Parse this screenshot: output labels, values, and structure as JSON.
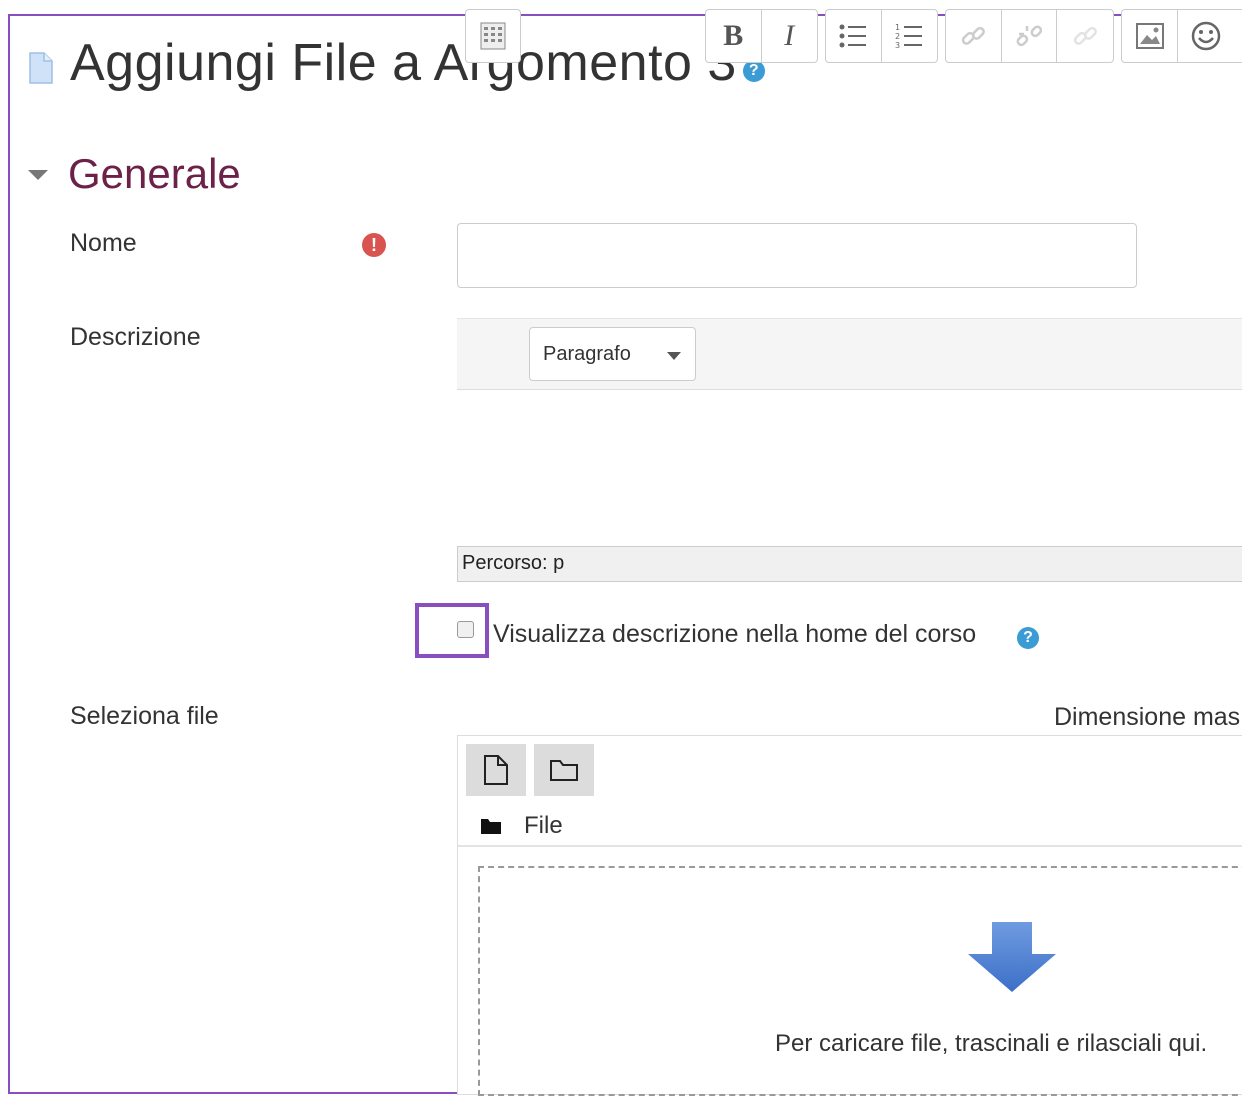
{
  "page": {
    "title": "Aggiungi File a Argomento 3",
    "title_icon": "file-icon",
    "title_help_icon": "help-icon"
  },
  "section": {
    "title": "Generale",
    "caret_icon": "caret-down-icon"
  },
  "fields": {
    "name_label": "Nome",
    "name_value": "",
    "description_label": "Descrizione",
    "select_file_label": "Seleziona file"
  },
  "editor": {
    "paragraph_select": "Paragrafo",
    "buttons": [
      "toggle-toolbar-icon",
      "bold-icon",
      "italic-icon",
      "unordered-list-icon",
      "ordered-list-icon",
      "link-icon",
      "unlink-icon",
      "anchor-icon",
      "image-icon",
      "emoticon-icon"
    ],
    "bold_label": "B",
    "italic_label": "I",
    "path": "Percorso: p"
  },
  "display_description": {
    "label": "Visualizza descrizione nella home del corso",
    "checked": false
  },
  "file_picker": {
    "max_size_label": "Dimensione mas",
    "path_label": "File",
    "dropzone_text": "Per caricare file, trascinali e rilasciali qui."
  },
  "colors": {
    "accent_frame": "#8a4fbf",
    "section_title": "#6b2148",
    "help_icon": "#3a9bd5",
    "required_icon": "#d9534f",
    "drop_arrow": "#4a7fd4"
  }
}
